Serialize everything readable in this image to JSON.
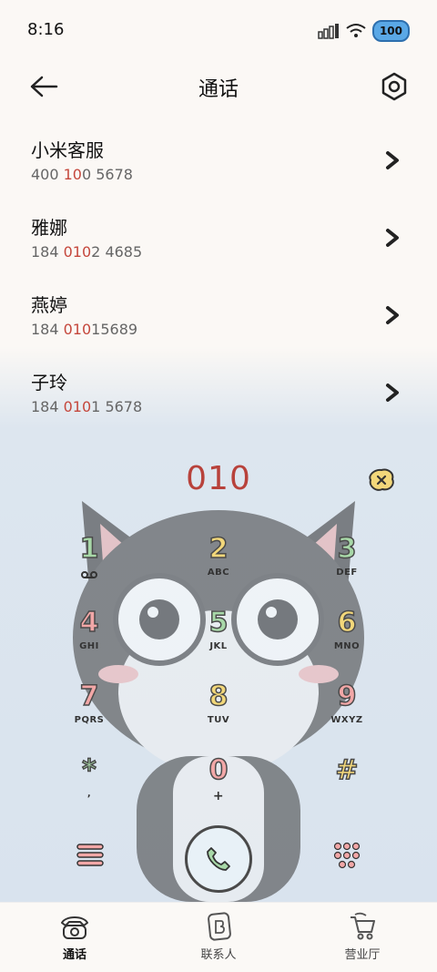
{
  "status": {
    "time": "8:16",
    "battery": "100"
  },
  "header": {
    "title": "通话"
  },
  "contacts": [
    {
      "name": "小米客服",
      "num_a": "400 ",
      "num_hl": "10",
      "num_b": "0 5678"
    },
    {
      "name": "雅娜",
      "num_a": "184 ",
      "num_hl": "010",
      "num_b": "2 4685"
    },
    {
      "name": "燕婷",
      "num_a": "184 ",
      "num_hl": "010",
      "num_b": "15689"
    },
    {
      "name": "子玲",
      "num_a": "184 ",
      "num_hl": "010",
      "num_b": "1 5678"
    }
  ],
  "dialer": {
    "display": "010",
    "keys": [
      {
        "digit": "1",
        "letters": ""
      },
      {
        "digit": "2",
        "letters": "ABC"
      },
      {
        "digit": "3",
        "letters": "DEF"
      },
      {
        "digit": "4",
        "letters": "GHI"
      },
      {
        "digit": "5",
        "letters": "JKL"
      },
      {
        "digit": "6",
        "letters": "MNO"
      },
      {
        "digit": "7",
        "letters": "PQRS"
      },
      {
        "digit": "8",
        "letters": "TUV"
      },
      {
        "digit": "9",
        "letters": "WXYZ"
      },
      {
        "digit": "*",
        "letters": ","
      },
      {
        "digit": "0",
        "letters": "+"
      },
      {
        "digit": "#",
        "letters": ""
      }
    ]
  },
  "tabs": [
    {
      "label": "通话",
      "icon": "telephone-icon"
    },
    {
      "label": "联系人",
      "icon": "contacts-book-icon"
    },
    {
      "label": "营业厅",
      "icon": "shopping-cart-icon"
    }
  ]
}
